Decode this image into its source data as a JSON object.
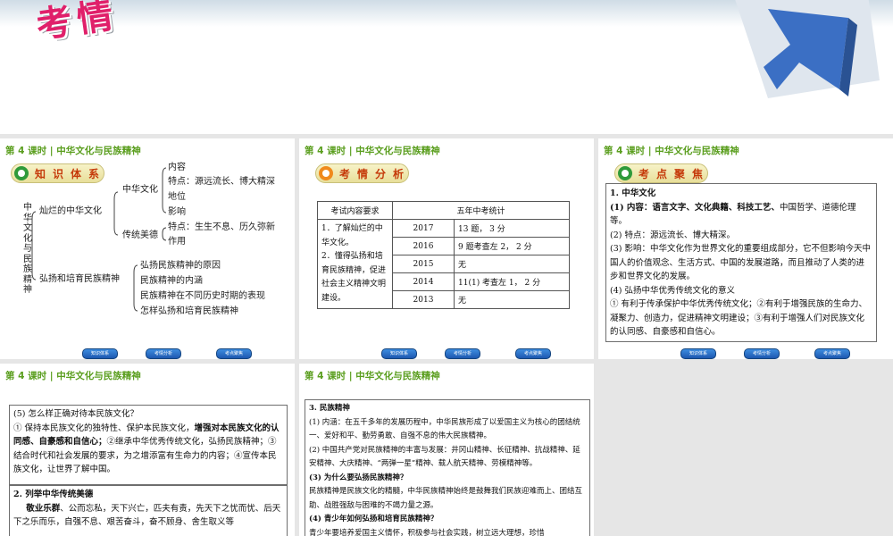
{
  "banner": {
    "title": "考情",
    "colors": {
      "title": "#e0206a",
      "arrow": "#3b6fc4"
    }
  },
  "header": "第 4 课时 | 中华文化与民族精神",
  "nav": {
    "btn1": "知识体系",
    "btn2": "考情分析",
    "btn3": "考点聚焦"
  },
  "slide1": {
    "pill": "知识体系",
    "root": "中华文化与民族精神",
    "branch1": "灿烂的中华文化",
    "b1_sub1": "中华文化",
    "b1_sub1_items": [
      "内容",
      "特点：源远流长、博大精深",
      "地位",
      "影响"
    ],
    "b1_sub2": "传统美德",
    "b1_sub2_items": [
      "特点：生生不息、历久弥新",
      "作用"
    ],
    "branch2": "弘扬和培育民族精神",
    "b2_items": [
      "弘扬民族精神的原因",
      "民族精神的内涵",
      "民族精神在不同历史时期的表现",
      "怎样弘扬和培育民族精神"
    ]
  },
  "slide2": {
    "pill": "考情分析",
    "col1": "考试内容要求",
    "col2": "五年中考统计",
    "req1": "1．了解灿烂的中华文化。",
    "req2": "2．懂得弘扬和培育民族精神，促进社会主义精神文明建设。",
    "rows": [
      {
        "year": "2017",
        "stat": "13 题， 3 分"
      },
      {
        "year": "2016",
        "stat": "9 题考查左 2， 2 分"
      },
      {
        "year": "2015",
        "stat": "无"
      },
      {
        "year": "2014",
        "stat": "11(1) 考查左 1， 2 分"
      },
      {
        "year": "2013",
        "stat": "无"
      }
    ]
  },
  "slide3": {
    "pill": "考点聚焦",
    "t1": "1. 中华文化",
    "p1a": "(1) 内容：",
    "p1b": "语言文字、文化典籍、科技工艺、",
    "p1c": "中国哲学、道德伦理等。",
    "p2": "(2) 特点：源远流长、博大精深。",
    "p3": "(3) 影响：中华文化作为世界文化的重要组成部分，它不但影响今天中国人的价值观念、生活方式、中国的发展道路，而且推动了人类的进步和世界文化的发展。",
    "p4": "(4) 弘扬中华优秀传统文化的意义",
    "p5": "① 有利于传承保护中华优秀传统文化；②有利于增强民族的生命力、凝聚力、创造力，促进精神文明建设；③有利于增强人们对民族文化的认同感、自豪感和自信心。"
  },
  "slide4": {
    "q5": "(5) 怎么样正确对待本民族文化？",
    "a5a": "① 保持本民族文化的独特性、保护本民族文化，",
    "a5b": "增强对本民族文化的认同感、自豪感和自信心；",
    "a5c": "②继承中华优秀传统文化，弘扬民族精神；",
    "a5d": "③结合时代和社会发展的要求，为之增添富有生命力的内容；",
    "a5e": "④宣传本民族文化，让世界了解中国。",
    "t2": "2. 列举中华传统美德",
    "m1": "敬业乐群",
    "m1b": "、公而忘私，天下兴亡，匹夫有责，先天下之忧而忧、后天下之乐而乐，自强不息、艰苦奋斗，奋不顾身、舍生取义等"
  },
  "slide5": {
    "t3": "3. 民族精神",
    "p1": "(1) 内涵：在五千多年的发展历程中，中华民族形成了以爱国主义为核心的团结统一、爱好和平、勤劳勇敢、自强不息的伟大民族精神。",
    "p2": "(2) 中国共产党对民族精神的丰富与发展：井冈山精神、长征精神、抗战精神、延安精神、大庆精神、“两弹一星”精神、载人航天精神、劳模精神等。",
    "p3": "(3) 为什么要弘扬民族精神？",
    "p3a": "民族精神是民族文化的精髓，中华民族精神始终是鼓舞我们民族迎难而上、团结互助、战胜强敌与困难的不竭力量之源。",
    "p4": "(4) 青少年如何弘扬和培育民族精神？",
    "p4a": "青少年要培养爱国主义情怀，积极参与社会实践，树立远大理想，珍惜"
  }
}
